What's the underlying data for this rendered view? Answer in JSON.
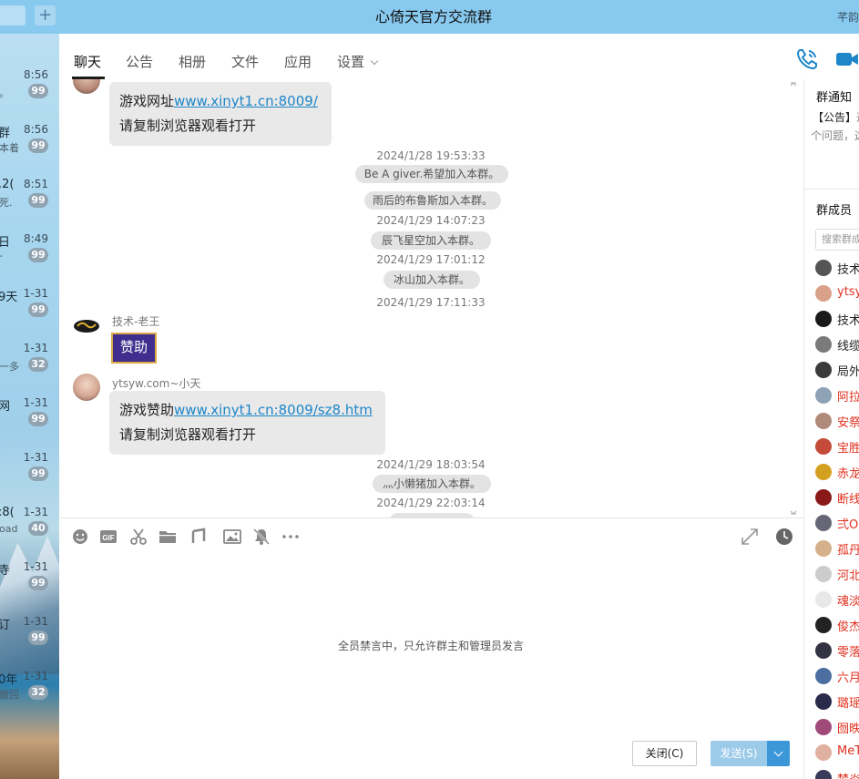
{
  "window": {
    "title": "心倚天官方交流群",
    "title_right_partial": "芊韵"
  },
  "left_list": {
    "items": [
      {
        "time": "8:56",
        "name": "",
        "preview": "。",
        "badge": "99"
      },
      {
        "time": "8:56",
        "name": "群",
        "preview": "本着",
        "badge": "99"
      },
      {
        "time": "8:51",
        "name": ".2(",
        "preview": "死.",
        "badge": "99"
      },
      {
        "time": "8:49",
        "name": "日",
        "preview": "-",
        "badge": "99"
      },
      {
        "time": "1-31",
        "name": "9天",
        "preview": "",
        "badge": "99"
      },
      {
        "time": "1-31",
        "name": "",
        "preview": "一多",
        "badge": "32"
      },
      {
        "time": "1-31",
        "name": "网",
        "preview": "",
        "badge": "99"
      },
      {
        "time": "1-31",
        "name": "",
        "preview": "",
        "badge": "99"
      },
      {
        "time": "1-31",
        "name": ":8(",
        "preview": "oad",
        "badge": "40"
      },
      {
        "time": "1-31",
        "name": "寺",
        "preview": "",
        "badge": "99"
      },
      {
        "time": "1-31",
        "name": "订",
        "preview": "",
        "badge": "99"
      },
      {
        "time": "1-31",
        "name": "0年",
        "preview": "撤回",
        "badge": "32"
      }
    ]
  },
  "tabs": {
    "chat": "聊天",
    "notice": "公告",
    "album": "相册",
    "files": "文件",
    "apps": "应用",
    "settings": "设置"
  },
  "messages": {
    "m1_line1_prefix": "游戏网址",
    "m1_link": "www.xinyt1.cn:8009/",
    "m1_line2": "请复制浏览器观看打开",
    "t1": "2024/1/28 19:53:33",
    "s1": "Be A giver.希望加入本群。",
    "s2": "雨后的布鲁斯加入本群。",
    "t2": "2024/1/29 14:07:23",
    "s3": "辰飞星空加入本群。",
    "t3": "2024/1/29 17:01:12",
    "s4": "冰山加入本群。",
    "t4": "2024/1/29 17:11:33",
    "sender1": "技术-老王",
    "sponsor": "赞助",
    "sender2": "ytsyw.com~小天",
    "m2_line1_prefix": "游戏赞助",
    "m2_link": "www.xinyt1.cn:8009/sz8.htm",
    "m2_line2": "请复制浏览器观看打开",
    "t5": "2024/1/29 18:03:54",
    "s5": "灬小懒猪加入本群。",
    "t6": "2024/1/29 22:03:14"
  },
  "input": {
    "mute_notice": "全员禁言中，只允许群主和管理员发言",
    "close_label": "关闭(C)",
    "send_label": "发送(S)"
  },
  "right_panel": {
    "notice_title": "群通知",
    "notice_line1": "【公告】",
    "notice_line1_tail": "这",
    "notice_line2": "个问题，",
    "notice_line2_tail": "这",
    "members_title": "群成员",
    "member_search_placeholder": "搜索群成员",
    "members": [
      {
        "name": "技术",
        "color": "#222222",
        "avatar": "#555555"
      },
      {
        "name": "ytsy",
        "color": "#e0301e",
        "avatar": "#d9a08a"
      },
      {
        "name": "技术",
        "color": "#222222",
        "avatar": "#1a1a1a"
      },
      {
        "name": "线缆",
        "color": "#222222",
        "avatar": "#7a7a7a"
      },
      {
        "name": "局外",
        "color": "#222222",
        "avatar": "#3a3a3a"
      },
      {
        "name": "阿拉",
        "color": "#e0301e",
        "avatar": "#8da2b5"
      },
      {
        "name": "安祭",
        "color": "#e0301e",
        "avatar": "#b08a7a"
      },
      {
        "name": "宝胜",
        "color": "#e0301e",
        "avatar": "#c44b3a"
      },
      {
        "name": "赤龙",
        "color": "#e0301e",
        "avatar": "#d4a020"
      },
      {
        "name": "断线",
        "color": "#e0301e",
        "avatar": "#8a1a1a"
      },
      {
        "name": "弍O",
        "color": "#e0301e",
        "avatar": "#666677"
      },
      {
        "name": "孤丹",
        "color": "#e0301e",
        "avatar": "#d6b08a"
      },
      {
        "name": "河北",
        "color": "#e0301e",
        "avatar": "#cccccc"
      },
      {
        "name": "魂淡",
        "color": "#e0301e",
        "avatar": "#e8e8e8"
      },
      {
        "name": "俊杰",
        "color": "#e0301e",
        "avatar": "#222222"
      },
      {
        "name": "零落",
        "color": "#e0301e",
        "avatar": "#333344"
      },
      {
        "name": "六月",
        "color": "#e0301e",
        "avatar": "#4a6fa0"
      },
      {
        "name": "璐瑶",
        "color": "#e0301e",
        "avatar": "#2a2a4a"
      },
      {
        "name": "囫昳",
        "color": "#e0301e",
        "avatar": "#a04a7a"
      },
      {
        "name": "MeT",
        "color": "#e0301e",
        "avatar": "#e0b0a0"
      },
      {
        "name": "梦炎",
        "color": "#e0301e",
        "avatar": "#3a3a5a"
      }
    ]
  }
}
